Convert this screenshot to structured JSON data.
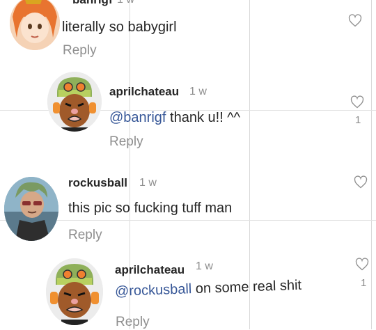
{
  "comments": [
    {
      "username": "banrigf",
      "time": "1 w",
      "text": "literally so babygirl",
      "reply_label": "Reply",
      "likes": ""
    },
    {
      "username": "aprilchateau",
      "time": "1 w",
      "mention": "@banrigf",
      "text": " thank u!! ^^",
      "reply_label": "Reply",
      "likes": "1"
    },
    {
      "username": "rockusball",
      "time": "1 w",
      "text": "this pic so fucking tuff man",
      "reply_label": "Reply",
      "likes": ""
    },
    {
      "username": "aprilchateau",
      "time": "1 w",
      "mention": "@rockusball",
      "text": " on some real shit",
      "reply_label": "Reply",
      "likes": "1"
    }
  ],
  "colors": {
    "mention": "#385898",
    "muted": "#8e8e8e",
    "text": "#262626"
  },
  "icons": [
    "heart-icon"
  ]
}
